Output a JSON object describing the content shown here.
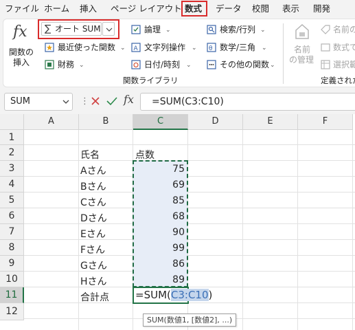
{
  "menu": {
    "tabs": [
      {
        "label": "ファイル"
      },
      {
        "label": "ホーム"
      },
      {
        "label": "挿入"
      },
      {
        "label": "ページ レイアウト"
      },
      {
        "label": "数式"
      },
      {
        "label": "データ"
      },
      {
        "label": "校閲"
      },
      {
        "label": "表示"
      },
      {
        "label": "開発"
      }
    ],
    "active_tab": "数式"
  },
  "ribbon": {
    "insert_function": {
      "icon_label": "fx",
      "label_line1": "関数の",
      "label_line2": "挿入"
    },
    "autosum": {
      "label": "オート SUM",
      "icon": "sigma-icon"
    },
    "recently_used": {
      "label": "最近使った関数"
    },
    "financial": {
      "label": "財務"
    },
    "logical": {
      "label": "論理"
    },
    "text": {
      "label": "文字列操作"
    },
    "datetime": {
      "label": "日付/時刻"
    },
    "lookup": {
      "label": "検索/行列"
    },
    "math": {
      "label": "数学/三角"
    },
    "more": {
      "label": "その他の関数"
    },
    "group_label": "関数ライブラリ",
    "defined_names": {
      "name_manager_line1": "名前",
      "name_manager_line2": "の管理",
      "define_name": "名前の",
      "use_in_formula": "数式で",
      "create_from_selection": "選択範",
      "group_label": "定義された名"
    }
  },
  "formula_bar": {
    "name_box": "SUM",
    "formula": "=SUM(C3:C10)",
    "fx_label": "fx"
  },
  "grid": {
    "columns": [
      "A",
      "B",
      "C",
      "D",
      "E",
      "F"
    ],
    "rows": [
      "1",
      "2",
      "3",
      "4",
      "5",
      "6",
      "7",
      "8",
      "9",
      "10",
      "11",
      "12"
    ],
    "header_name": "氏名",
    "header_score": "点数",
    "entries": [
      {
        "name": "Aさん",
        "score": "75"
      },
      {
        "name": "Bさん",
        "score": "69"
      },
      {
        "name": "Cさん",
        "score": "85"
      },
      {
        "name": "Dさん",
        "score": "68"
      },
      {
        "name": "Eさん",
        "score": "90"
      },
      {
        "name": "Fさん",
        "score": "99"
      },
      {
        "name": "Gさん",
        "score": "86"
      },
      {
        "name": "Hさん",
        "score": "89"
      }
    ],
    "total_label": "合計点",
    "formula_prefix": "=SUM(",
    "formula_ref": "C3:C10",
    "formula_suffix": ")",
    "tooltip": "SUM(数値1, [数値2], ...)"
  },
  "colors": {
    "accent_green": "#217346",
    "highlight_red": "#d92b2b",
    "range_fill": "#e7edf7",
    "ref_blue": "#3a6fb6"
  }
}
